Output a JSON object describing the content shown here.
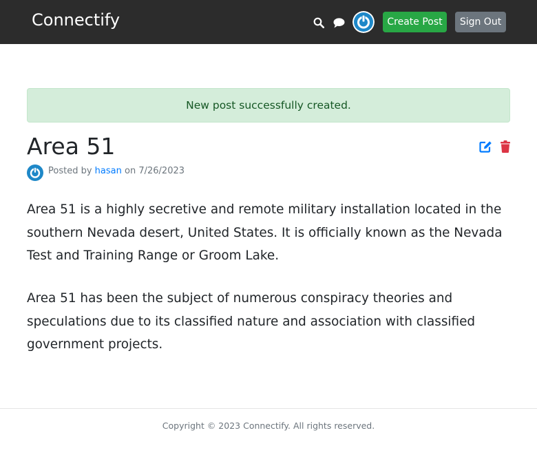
{
  "app": {
    "brand": "Connectify"
  },
  "header": {
    "icons": [
      "search-icon",
      "chat-icon",
      "avatar-icon"
    ],
    "create_label": "Create Post",
    "signout_label": "Sign Out"
  },
  "alert": {
    "message": "New post successfully created."
  },
  "post": {
    "title": "Area 51",
    "posted_by_prefix": "Posted by",
    "author": "hasan",
    "date_prefix": "on",
    "date": "7/26/2023",
    "paragraphs": [
      "Area 51 is a highly secretive and remote military installation located in the southern Nevada desert, United States. It is officially known as the Nevada Test and Training Range or Groom Lake.",
      "Area 51 has been the subject of numerous conspiracy theories and speculations due to its classified nature and association with classified government projects."
    ],
    "action_icons": [
      "edit-icon",
      "trash-icon"
    ]
  },
  "footer": {
    "text": "Copyright © 2023 Connectify. All rights reserved."
  },
  "colors": {
    "topbar": "#2c2c2c",
    "create_button": "#28a745",
    "signout_button": "#6c757d",
    "alert_bg": "#d4edda",
    "alert_text": "#155724",
    "link": "#007bff",
    "edit": "#007bff",
    "delete": "#dc3545",
    "avatar": "#1e88c8"
  }
}
